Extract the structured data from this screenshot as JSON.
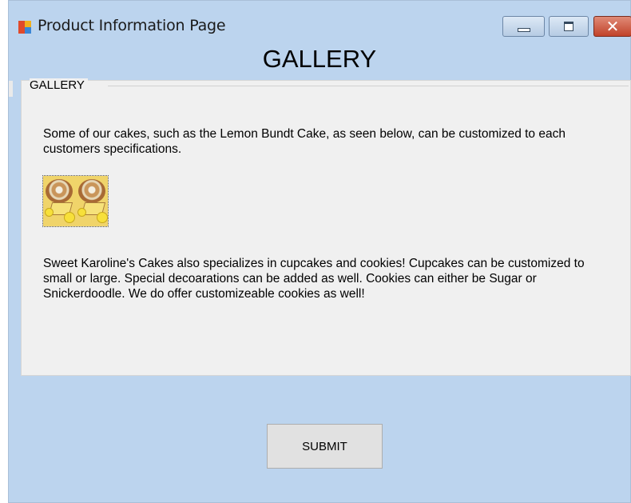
{
  "window": {
    "title": "Product Information Page",
    "accent_color": "#bcd4ee",
    "icon": "app-window-icon",
    "controls": {
      "minimize_icon": "minimize-icon",
      "maximize_icon": "maximize-icon",
      "close_glyph": "✕"
    }
  },
  "page": {
    "heading": "GALLERY"
  },
  "gallery": {
    "legend": "GALLERY",
    "intro_text": "Some of our cakes, such as the Lemon Bundt Cake, as seen below, can be customized to each customers specifications.",
    "image_subject": "lemon-bundt-cake",
    "details_text": "Sweet Karoline's Cakes also specializes in cupcakes and cookies!  Cupcakes can be customized to small or large.  Special decoarations can be added as well.  Cookies can either be Sugar or Snickerdoodle.  We do offer customizeable cookies as well!"
  },
  "actions": {
    "submit_label": "SUBMIT"
  }
}
